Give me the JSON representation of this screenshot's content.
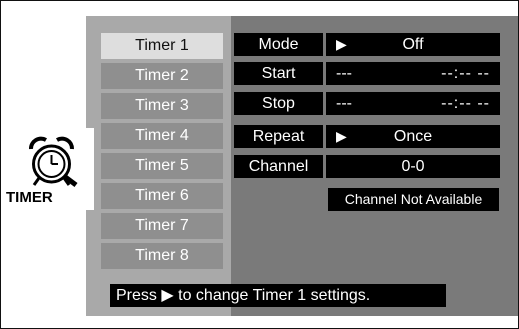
{
  "timers": [
    {
      "label": "Timer 1",
      "selected": true
    },
    {
      "label": "Timer 2",
      "selected": false
    },
    {
      "label": "Timer 3",
      "selected": false
    },
    {
      "label": "Timer 4",
      "selected": false
    },
    {
      "label": "Timer 5",
      "selected": false
    },
    {
      "label": "Timer 6",
      "selected": false
    },
    {
      "label": "Timer 7",
      "selected": false
    },
    {
      "label": "Timer 8",
      "selected": false
    }
  ],
  "settings": {
    "mode": {
      "label": "Mode",
      "arrow": "▶",
      "value": "Off"
    },
    "start": {
      "label": "Start",
      "left": "---",
      "right": "--:-- --"
    },
    "stop": {
      "label": "Stop",
      "left": "---",
      "right": "--:-- --"
    },
    "repeat": {
      "label": "Repeat",
      "arrow": "▶",
      "value": "Once"
    },
    "channel": {
      "label": "Channel",
      "value": "0-0"
    }
  },
  "notice": "Channel Not Available",
  "help": {
    "prefix": "Press",
    "arrow": "▶",
    "suffix": "to change Timer 1 settings."
  },
  "logo": {
    "text": "TIMER",
    "icon": "alarm-clock-magnifier-icon"
  },
  "colors": {
    "panel": "#7a7a7a",
    "left_col": "#a9a9a9",
    "item": "#8f8f8f",
    "selected": "#dedede",
    "black": "#000000"
  }
}
